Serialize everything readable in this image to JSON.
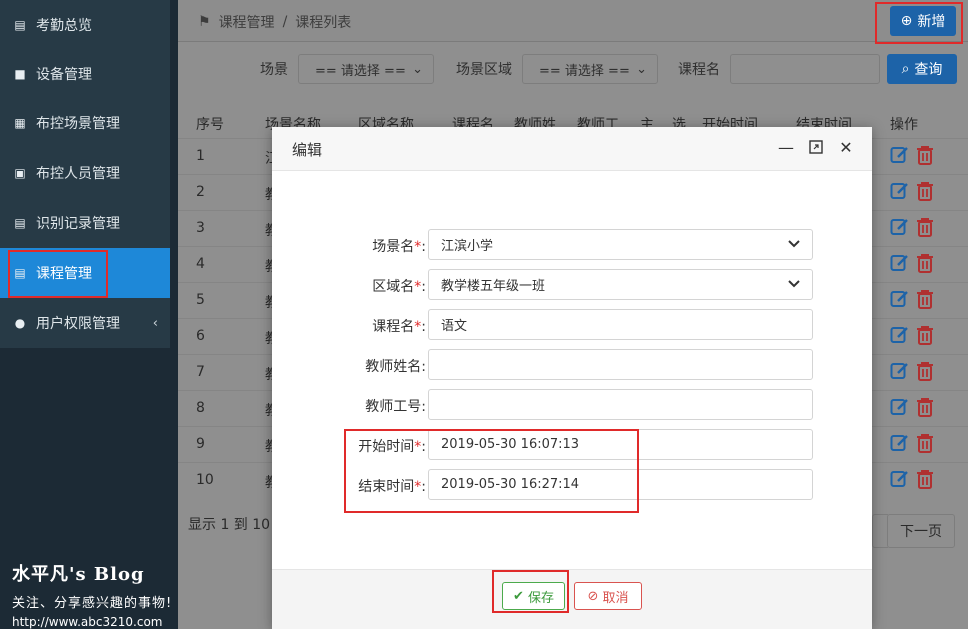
{
  "sidebar": {
    "items": [
      {
        "label": "考勤总览",
        "icon": "id-card-icon"
      },
      {
        "label": "设备管理",
        "icon": "video-camera-icon"
      },
      {
        "label": "布控场景管理",
        "icon": "grid-icon"
      },
      {
        "label": "布控人员管理",
        "icon": "person-card-icon"
      },
      {
        "label": "识别记录管理",
        "icon": "list-card-icon"
      },
      {
        "label": "课程管理",
        "icon": "list-card-icon",
        "active": true
      },
      {
        "label": "用户权限管理",
        "icon": "user-icon",
        "chevron": "‹"
      }
    ]
  },
  "watermark": {
    "title": "水平凡's Blog",
    "subtitle": "关注、分享感兴趣的事物!",
    "url": "http://www.abc3210.com"
  },
  "header": {
    "breadcrumb": [
      "课程管理",
      "/",
      "课程列表"
    ],
    "add_button": "新增"
  },
  "filters": {
    "scene_label": "场景",
    "scene_select": "== 请选择 ==",
    "area_label": "场景区域",
    "area_select": "== 请选择 ==",
    "course_label": "课程名",
    "course_value": "",
    "query_button": "查询"
  },
  "table": {
    "columns": [
      "序号",
      "场景名称",
      "区域名称",
      "课程名",
      "教师姓",
      "教师工",
      "主",
      "选",
      "开始时间",
      "结束时间",
      "操作"
    ],
    "rows": [
      {
        "no": "1",
        "c2": "江"
      },
      {
        "no": "2",
        "c2": "教"
      },
      {
        "no": "3",
        "c2": "教"
      },
      {
        "no": "4",
        "c2": "教"
      },
      {
        "no": "5",
        "c2": "教"
      },
      {
        "no": "6",
        "c2": "教"
      },
      {
        "no": "7",
        "c2": "教"
      },
      {
        "no": "8",
        "c2": "教"
      },
      {
        "no": "9",
        "c2": "教"
      },
      {
        "no": "10",
        "c2": "教"
      }
    ],
    "footer_info": "显示 1 到 10",
    "next_page": "下一页"
  },
  "modal": {
    "title": "编辑",
    "fields": [
      {
        "label": "场景名",
        "required": true,
        "value": "江滨小学",
        "type": "select"
      },
      {
        "label": "区域名",
        "required": true,
        "value": "教学楼五年级一班",
        "type": "select"
      },
      {
        "label": "课程名",
        "required": true,
        "value": "语文",
        "type": "input"
      },
      {
        "label": "教师姓名",
        "required": false,
        "value": "",
        "type": "input"
      },
      {
        "label": "教师工号",
        "required": false,
        "value": "",
        "type": "input"
      },
      {
        "label": "开始时间",
        "required": true,
        "value": "2019-05-30 16:07:13",
        "type": "input"
      },
      {
        "label": "结束时间",
        "required": true,
        "value": "2019-05-30 16:27:14",
        "type": "input"
      }
    ],
    "save_button": "保存",
    "cancel_button": "取消",
    "colon": ":"
  },
  "colors": {
    "sidebar_bg": "#273a46",
    "active": "#1e88d8",
    "primary_button": "#1d63a8",
    "highlight_box": "#e02a2a",
    "save": "#4caa4c",
    "cancel": "#d9534f"
  }
}
